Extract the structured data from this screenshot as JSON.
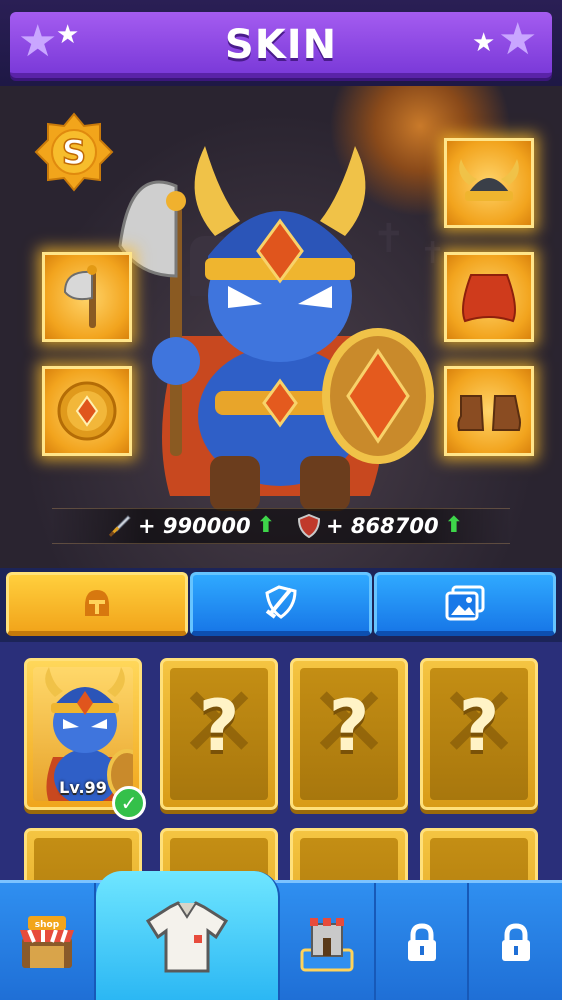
{
  "header": {
    "title": "SKIN"
  },
  "stats": {
    "attack": "+ 990000",
    "defense": "+ 868700"
  },
  "equipment": {
    "left": [
      "axe-icon",
      "medallion-icon"
    ],
    "right": [
      "horned-helmet-icon",
      "red-cape-icon",
      "boots-icon"
    ]
  },
  "tabs": [
    {
      "icon": "helmet-icon",
      "active": true
    },
    {
      "icon": "sword-shield-icon",
      "active": false
    },
    {
      "icon": "picture-icon",
      "active": false
    }
  ],
  "cards": [
    {
      "owned": true,
      "level": "Lv.99"
    },
    {
      "owned": false,
      "symbol": "?"
    },
    {
      "owned": false,
      "symbol": "?"
    },
    {
      "owned": false,
      "symbol": "?"
    }
  ],
  "nav": {
    "shop_label": "shop",
    "items": [
      "shop-icon",
      "shirt-icon",
      "castle-icon",
      "lock-icon",
      "lock-icon"
    ]
  },
  "colors": {
    "accent_purple": "#8a45e6",
    "gold": "#f2a51b",
    "blue": "#1f6fd6",
    "green": "#34c04a"
  }
}
